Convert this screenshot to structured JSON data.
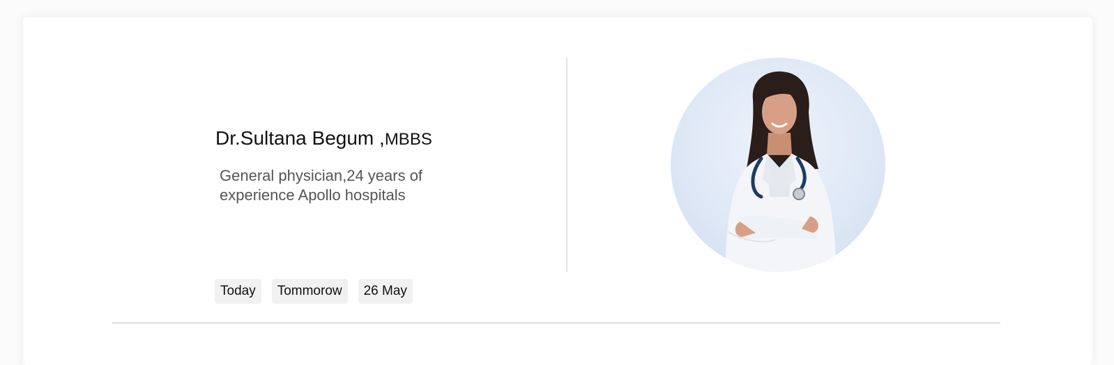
{
  "doctor": {
    "name": "Dr.Sultana Begum ,",
    "degree": "MBBS",
    "description": "General physician,24 years of experience Apollo hospitals"
  },
  "dates": [
    {
      "label": "Today"
    },
    {
      "label": "Tommorow"
    },
    {
      "label": "26 May"
    }
  ],
  "colors": {
    "card_background": "#ffffff",
    "avatar_background": "#dde7f5",
    "chip_background": "#f1f1f1",
    "text_secondary": "#555555"
  }
}
